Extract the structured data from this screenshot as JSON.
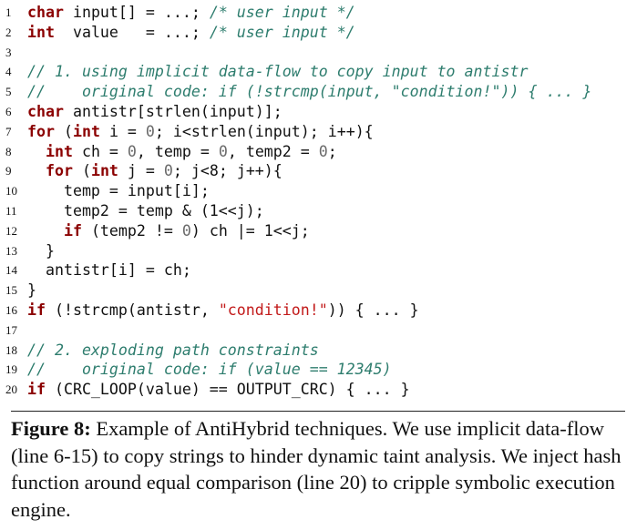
{
  "code": {
    "lines": [
      {
        "n": "1",
        "tokens": [
          [
            "kw",
            "char"
          ],
          [
            "t",
            " input[] = ...; "
          ],
          [
            "cm",
            "/* user input */"
          ]
        ]
      },
      {
        "n": "2",
        "tokens": [
          [
            "kw",
            "int"
          ],
          [
            "t",
            "  value   = ...; "
          ],
          [
            "cm",
            "/* user input */"
          ]
        ]
      },
      {
        "n": "3",
        "tokens": []
      },
      {
        "n": "4",
        "tokens": [
          [
            "cm",
            "// 1. using implicit data-flow to copy input to antistr"
          ]
        ]
      },
      {
        "n": "5",
        "tokens": [
          [
            "cm",
            "//    original code: if (!strcmp(input, \"condition!\")) { ... }"
          ]
        ]
      },
      {
        "n": "6",
        "tokens": [
          [
            "kw",
            "char"
          ],
          [
            "t",
            " antistr[strlen(input)];"
          ]
        ]
      },
      {
        "n": "7",
        "tokens": [
          [
            "kw",
            "for"
          ],
          [
            "t",
            " ("
          ],
          [
            "kw",
            "int"
          ],
          [
            "t",
            " i = "
          ],
          [
            "num",
            "0"
          ],
          [
            "t",
            "; i<strlen(input); i++){"
          ]
        ]
      },
      {
        "n": "8",
        "tokens": [
          [
            "t",
            "  "
          ],
          [
            "kw",
            "int"
          ],
          [
            "t",
            " ch = "
          ],
          [
            "num",
            "0"
          ],
          [
            "t",
            ", temp = "
          ],
          [
            "num",
            "0"
          ],
          [
            "t",
            ", temp2 = "
          ],
          [
            "num",
            "0"
          ],
          [
            "t",
            ";"
          ]
        ]
      },
      {
        "n": "9",
        "tokens": [
          [
            "t",
            "  "
          ],
          [
            "kw",
            "for"
          ],
          [
            "t",
            " ("
          ],
          [
            "kw",
            "int"
          ],
          [
            "t",
            " j = "
          ],
          [
            "num",
            "0"
          ],
          [
            "t",
            "; j<8; j++){"
          ]
        ]
      },
      {
        "n": "10",
        "tokens": [
          [
            "t",
            "    temp = input[i];"
          ]
        ]
      },
      {
        "n": "11",
        "tokens": [
          [
            "t",
            "    temp2 = temp & (1<<j);"
          ]
        ]
      },
      {
        "n": "12",
        "tokens": [
          [
            "t",
            "    "
          ],
          [
            "kw",
            "if"
          ],
          [
            "t",
            " (temp2 != "
          ],
          [
            "num",
            "0"
          ],
          [
            "t",
            ") ch |= 1<<j;"
          ]
        ]
      },
      {
        "n": "13",
        "tokens": [
          [
            "t",
            "  }"
          ]
        ]
      },
      {
        "n": "14",
        "tokens": [
          [
            "t",
            "  antistr[i] = ch;"
          ]
        ]
      },
      {
        "n": "15",
        "tokens": [
          [
            "t",
            "}"
          ]
        ]
      },
      {
        "n": "16",
        "tokens": [
          [
            "kw",
            "if"
          ],
          [
            "t",
            " (!strcmp(antistr, "
          ],
          [
            "str",
            "\"condition!\""
          ],
          [
            "t",
            ")) { ... }"
          ]
        ]
      },
      {
        "n": "17",
        "tokens": []
      },
      {
        "n": "18",
        "tokens": [
          [
            "cm",
            "// 2. exploding path constraints"
          ]
        ]
      },
      {
        "n": "19",
        "tokens": [
          [
            "cm",
            "//    original code: if (value == 12345)"
          ]
        ]
      },
      {
        "n": "20",
        "tokens": [
          [
            "kw",
            "if"
          ],
          [
            "t",
            " (CRC_LOOP(value) == OUTPUT_CRC) { ... }"
          ]
        ]
      }
    ]
  },
  "caption": {
    "label": "Figure 8:",
    "text": " Example of AntiHybrid techniques. We use implicit data-flow (line 6-15) to copy strings to hinder dynamic taint analysis. We inject hash function around equal comparison (line 20) to cripple symbolic execution engine."
  }
}
